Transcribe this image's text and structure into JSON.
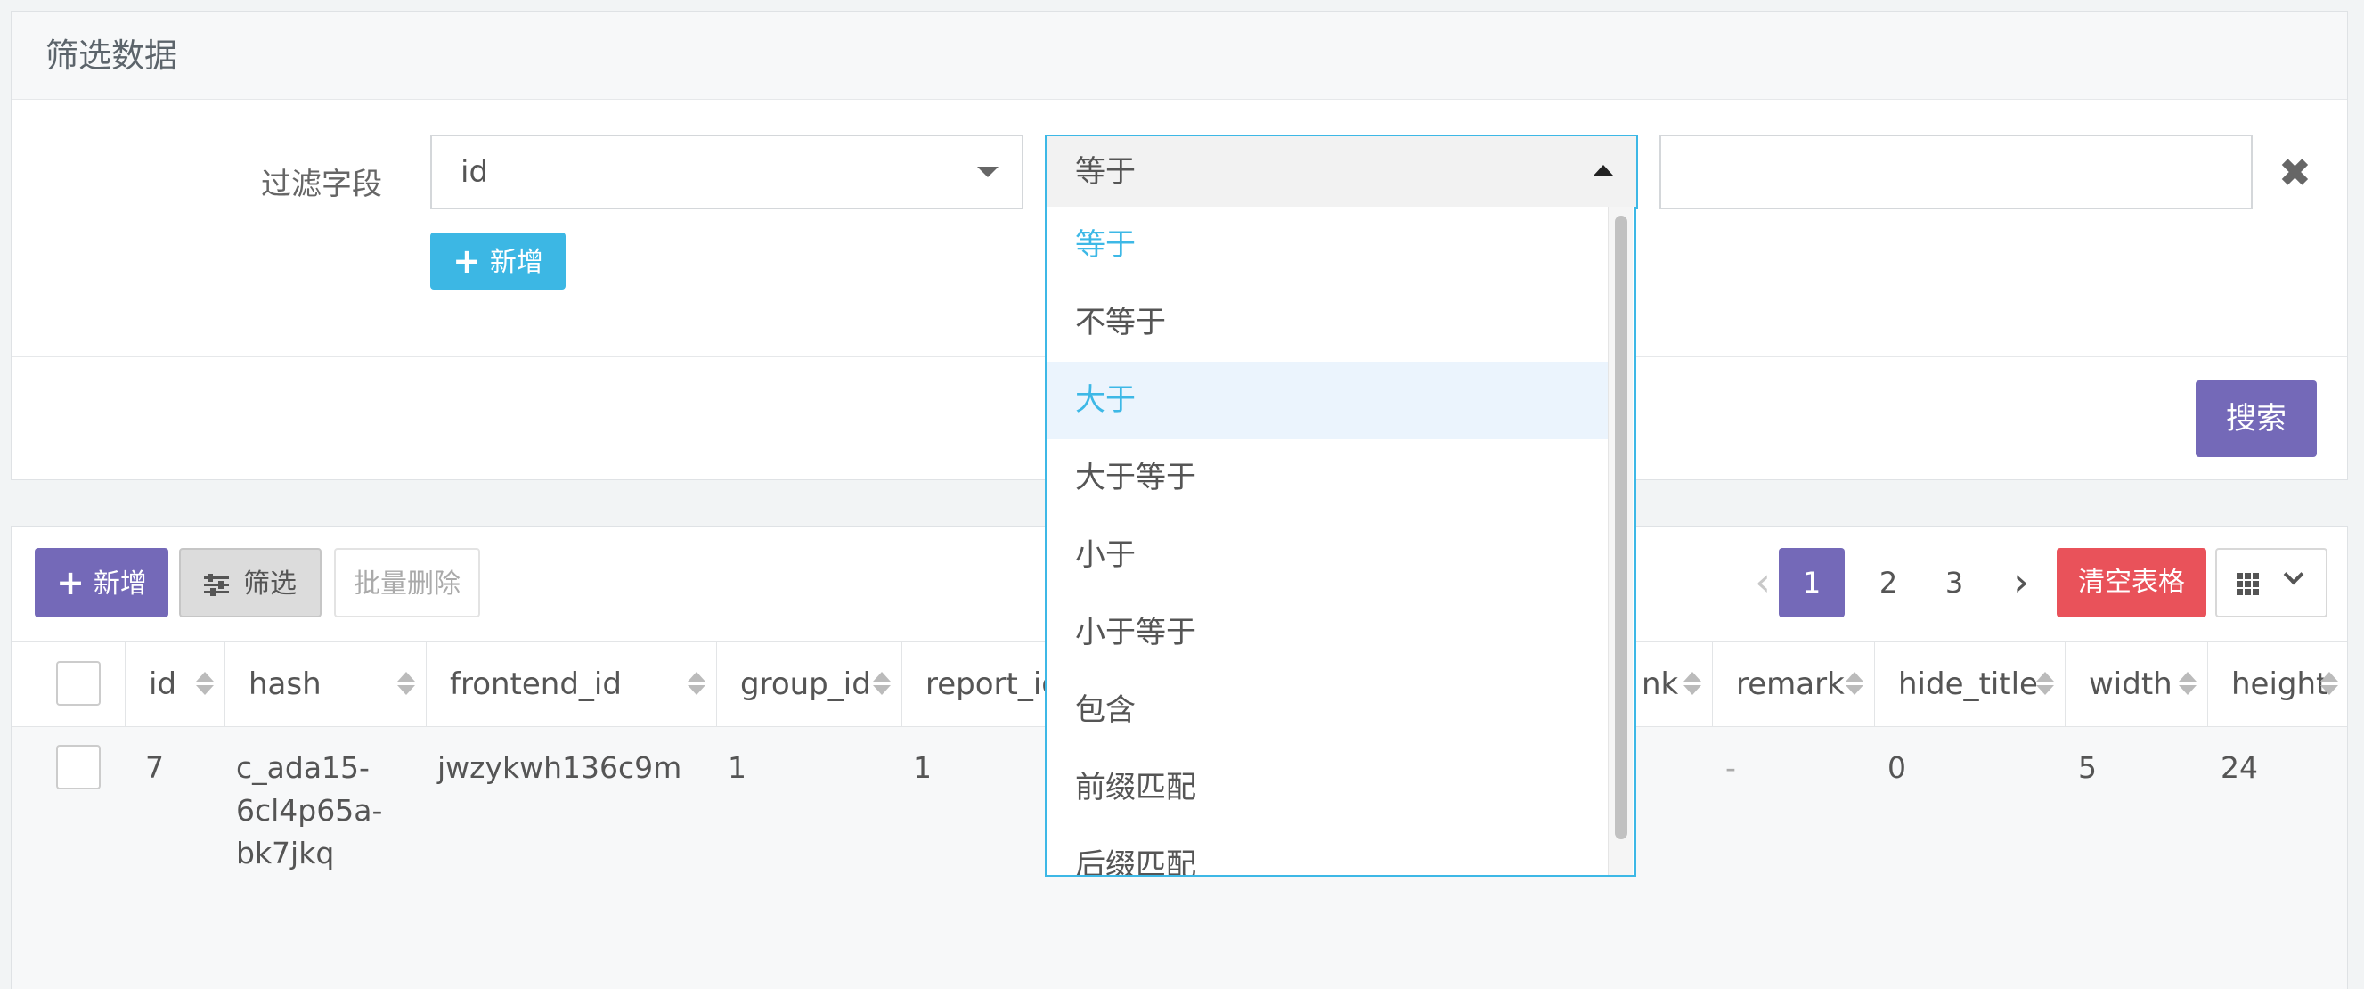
{
  "filter": {
    "title": "筛选数据",
    "field_label": "过滤字段",
    "field_value": "id",
    "operator_value": "等于",
    "value_input": "",
    "add_label": "新增",
    "search_label": "搜索",
    "operator_options": [
      "等于",
      "不等于",
      "大于",
      "大于等于",
      "小于",
      "小于等于",
      "包含",
      "前缀匹配",
      "后缀匹配"
    ],
    "selected_option": "等于",
    "hovered_option": "大于"
  },
  "toolbar": {
    "add_label": "新增",
    "filter_label": "筛选",
    "batch_delete_label": "批量删除",
    "clear_label": "清空表格"
  },
  "pagination": {
    "current": "1",
    "pages": [
      "1",
      "2",
      "3"
    ]
  },
  "table": {
    "headers": {
      "id": "id",
      "hash": "hash",
      "frontend_id": "frontend_id",
      "group_id": "group_id",
      "report_id": "report_id",
      "link": "nk",
      "remark": "remark",
      "hide_title": "hide_title",
      "width": "width",
      "height": "height"
    },
    "row": {
      "id": "7",
      "hash_lines": [
        "c_ada15-",
        "6cl4p65a-",
        "bk7jkq"
      ],
      "frontend_id": "jwzykwh136c9m",
      "group_id": "1",
      "report_id": "1",
      "remark": "-",
      "hide_title": "0",
      "width": "5",
      "height": "24"
    }
  },
  "colors": {
    "primary": "#7469b8",
    "info": "#3cb7e4",
    "danger": "#e9525a"
  }
}
